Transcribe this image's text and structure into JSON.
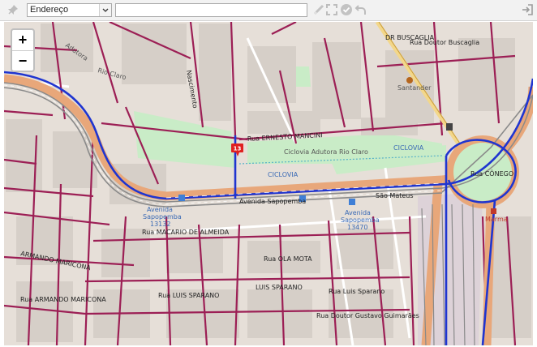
{
  "toolbar": {
    "pin_icon": "pin-icon",
    "search_type": "Endereço",
    "address_value": "",
    "address_placeholder": "",
    "icons": [
      "ruler-icon",
      "fullscreen-icon",
      "check-circle-icon",
      "undo-icon",
      "exit-icon"
    ]
  },
  "map": {
    "zoom_in_label": "+",
    "zoom_out_label": "−",
    "stop_marker_label": "13",
    "labels": {
      "avenida_sapopemba": "Avenida Sapopemba",
      "rua_ernesto_mancini": "Rua ERNESTO MANCINI",
      "ciclovia_adutora_rio_claro": "Ciclovia Adutora Rio Claro",
      "ciclovia": "CICLOVIA",
      "sao_mateus": "São Mateus",
      "av_sapopemba_13132_a": "Avenida",
      "av_sapopemba_13132_b": "Sapopemba",
      "av_sapopemba_13132_c": "13132",
      "av_sapopemba_13470_a": "Avenida",
      "av_sapopemba_13470_b": "Sapopemba",
      "av_sapopemba_13470_c": "13470",
      "santander": "Santander",
      "marma": "Marma",
      "rua_doutor_buscaglia": "Rua Doutor Buscaglia",
      "rua_dr_buscaglia_caps": "DR BUSCAGLIA",
      "rio_claro": "Rio Claro",
      "adutora": "Adutora",
      "nascimento": "Nascimento",
      "rua_luis_sparano": "Rua LUIS SPARANO",
      "luis_sparano_caps": "LUIS SPARANO",
      "rua_macario_de_almeida": "Rua MACARIO DE ALMEIDA",
      "rua_ola_mota": "Rua OLA MOTA",
      "rua_gustavo_guimaraes": "Rua Doutor Gustavo Guimarães",
      "rua_luis_sparano_2": "Rua Luis Sparano",
      "armando_maricona": "ARMANDO MARICONA",
      "armando_maricona_2": "Rua ARMANDO MARICONA",
      "rua_conego": "Rua CÔNEGO"
    }
  }
}
